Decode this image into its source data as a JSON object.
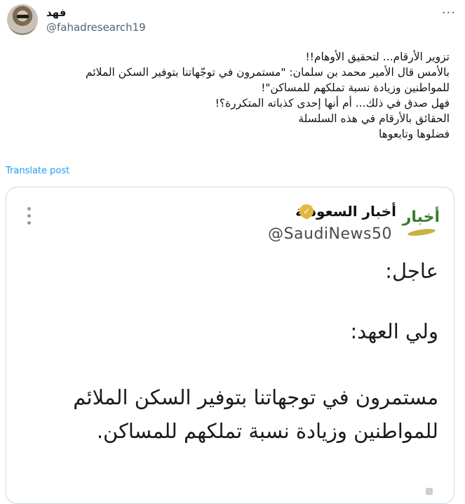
{
  "tweet": {
    "author_name": "فهد",
    "author_handle": "@fahadresearch19",
    "more_icon": "ellipsis-horizontal-icon",
    "lines": [
      "تزوير الأرقام... لتحقيق الأوهام!!",
      "بالأمس قال الأمير محمد بن سلمان: \"مستمرون في توجّهاتنا بتوفير السكن الملائم",
      "للمواطنين وزيادة نسبة تملكهم للمساكن\"!",
      "فهل صدق في ذلك... أم أنها إحدى كذباته المتكررة؟!",
      "الحقائق بالأرقام في هذه السلسلة",
      "فضلوها وتابعوها"
    ],
    "translate_label": "Translate post"
  },
  "media": {
    "logo_text": "أخبار",
    "source_name": "أخبار السعودية",
    "source_handle": "@SaudiNews50",
    "verified_icon": "verified-badge-icon",
    "menu_icon": "kebab-menu-icon",
    "lines": [
      "عاجل:",
      "ولي العهد:",
      "مستمرون في توجهاتنا بتوفير السكن الملائم",
      "للمواطنين وزيادة نسبة تملكهم للمساكن."
    ]
  },
  "colors": {
    "link": "#1d9bf0",
    "muted": "#536471",
    "border": "#cfd9de",
    "badge": "#e2b93b",
    "logo_green": "#3a7d2c"
  }
}
